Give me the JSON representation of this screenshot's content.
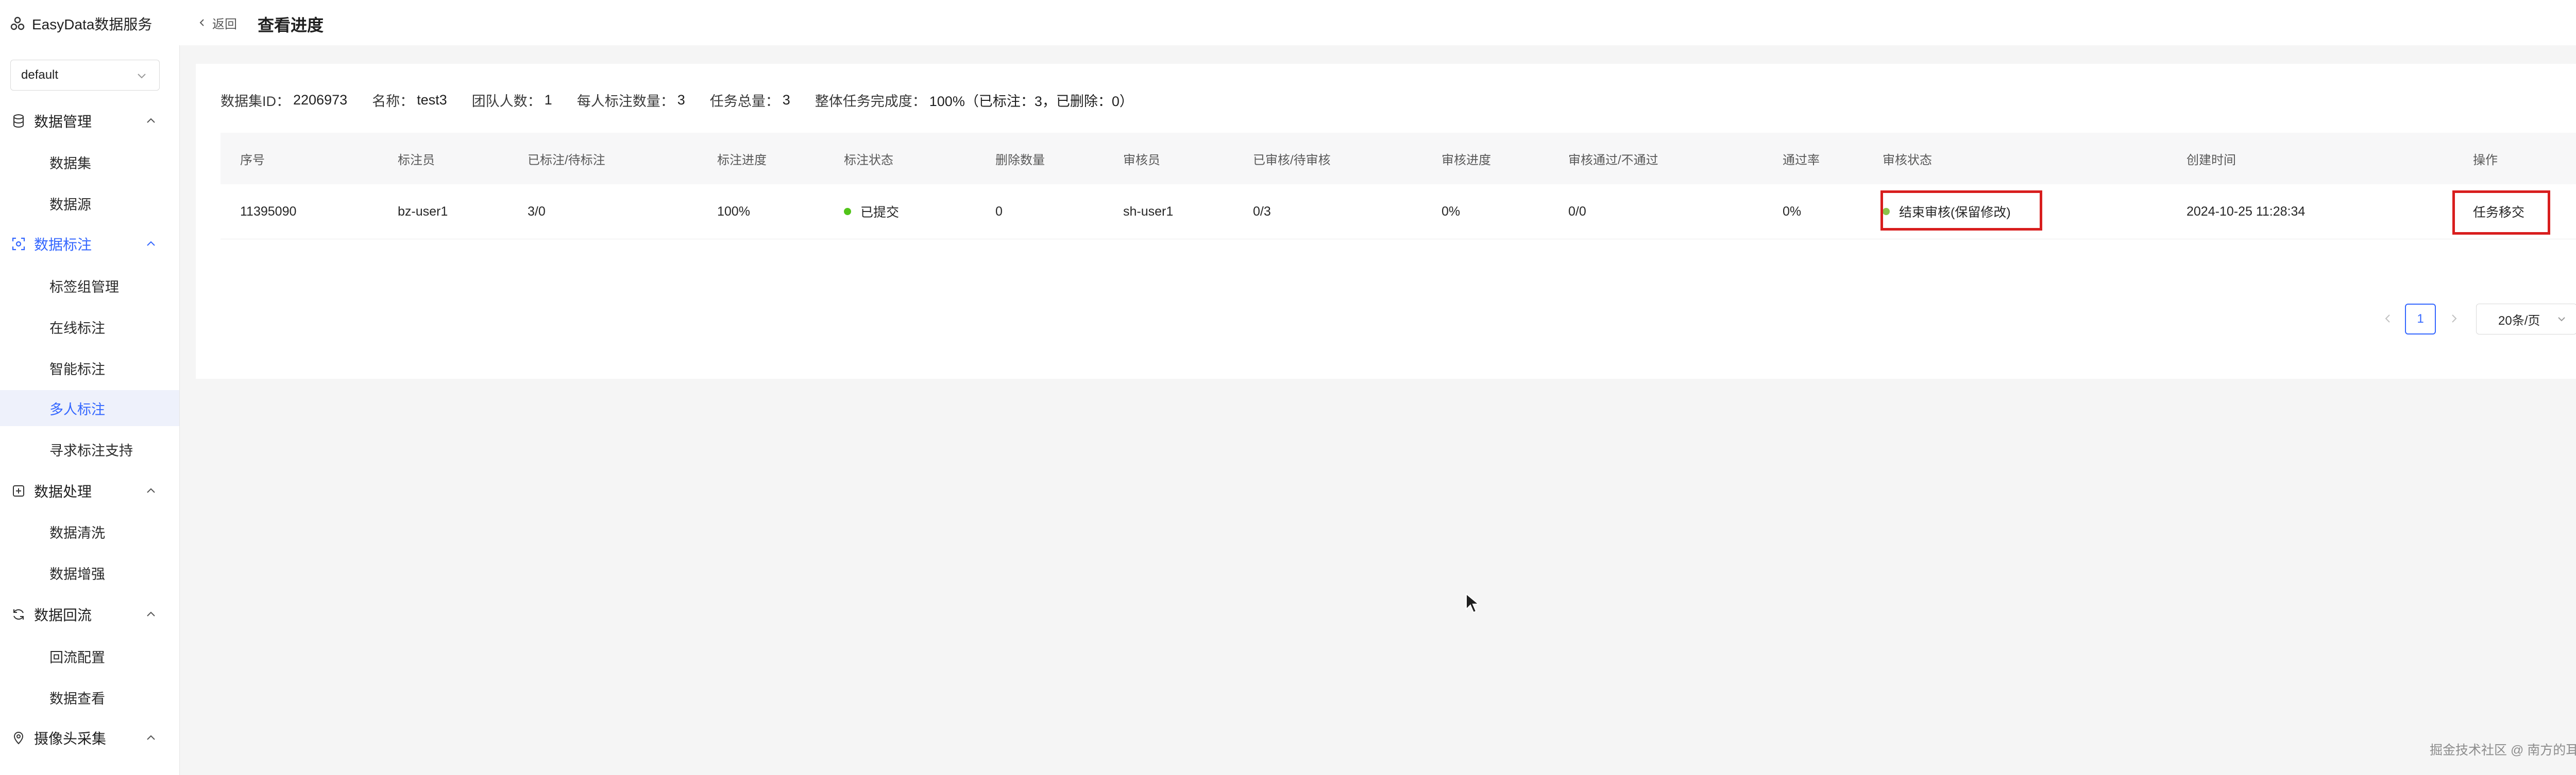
{
  "brand": {
    "name": "EasyData数据服务"
  },
  "workspace": {
    "value": "default"
  },
  "sidebar": {
    "groups": [
      {
        "label": "数据管理",
        "items": [
          "数据集",
          "数据源"
        ]
      },
      {
        "label": "数据标注",
        "items": [
          "标签组管理",
          "在线标注",
          "智能标注",
          "多人标注",
          "寻求标注支持"
        ]
      },
      {
        "label": "数据处理",
        "items": [
          "数据清洗",
          "数据增强"
        ]
      },
      {
        "label": "数据回流",
        "items": [
          "回流配置",
          "数据查看"
        ]
      },
      {
        "label": "摄像头采集",
        "items": []
      }
    ],
    "active_group": "数据标注",
    "selected_item": "多人标注"
  },
  "header": {
    "back_label": "返回",
    "title": "查看进度"
  },
  "summary": {
    "dataset_id_label": "数据集ID：",
    "dataset_id": "2206973",
    "name_label": "名称：",
    "name": "test3",
    "team_label": "团队人数：",
    "team": "1",
    "per_person_label": "每人标注数量：",
    "per_person": "3",
    "total_label": "任务总量：",
    "total": "3",
    "completion_label": "整体任务完成度：",
    "completion": "100%（已标注：3，已删除：0）"
  },
  "table": {
    "columns": [
      "序号",
      "标注员",
      "已标注/待标注",
      "标注进度",
      "标注状态",
      "删除数量",
      "审核员",
      "已审核/待审核",
      "审核进度",
      "审核通过/不通过",
      "通过率",
      "审核状态",
      "创建时间",
      "操作"
    ],
    "rows": [
      {
        "id": "11395090",
        "annotator": "bz-user1",
        "annotated": "3/0",
        "progress": "100%",
        "status": "已提交",
        "deleted": "0",
        "reviewer": "sh-user1",
        "reviewed": "0/3",
        "review_progress": "0%",
        "pass_fail": "0/0",
        "pass_rate": "0%",
        "review_status": "结束审核(保留修改)",
        "created": "2024-10-25 11:28:34",
        "action": "任务移交"
      }
    ]
  },
  "pagination": {
    "current_page": "1",
    "page_size": "20条/页"
  },
  "watermark": "掘金技术社区 @ 南方的耳朵",
  "colors": {
    "accent": "#3366ff",
    "status_green": "#52c41a",
    "review_status": "#8bc34a",
    "highlight": "#d81e1e"
  }
}
